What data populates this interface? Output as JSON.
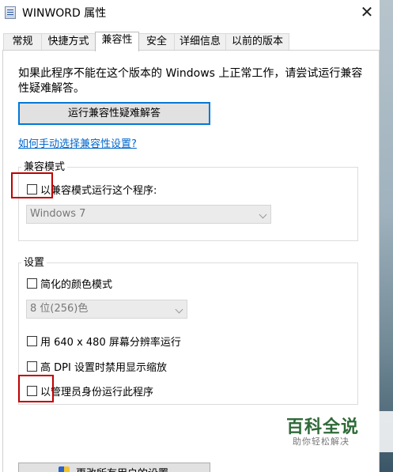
{
  "window": {
    "title": "WINWORD 属性",
    "close_glyph": "✕"
  },
  "tabs": [
    {
      "label": "常规"
    },
    {
      "label": "快捷方式"
    },
    {
      "label": "兼容性"
    },
    {
      "label": "安全"
    },
    {
      "label": "详细信息"
    },
    {
      "label": "以前的版本"
    }
  ],
  "active_tab": "兼容性",
  "compat": {
    "intro": "如果此程序不能在这个版本的 Windows 上正常工作，请尝试运行兼容性疑难解答。",
    "troubleshoot_button": "运行兼容性疑难解答",
    "manual_link": "如何手动选择兼容性设置?",
    "mode_group_label": "兼容模式",
    "mode_checkbox": "以兼容模式运行这个程序:",
    "mode_select": "Windows 7",
    "settings_group_label": "设置",
    "reduced_color": "简化的颜色模式",
    "color_select": "8 位(256)色",
    "low_res": "用 640 x 480 屏幕分辨率运行",
    "dpi": "高 DPI 设置时禁用显示缩放",
    "admin": "以管理员身份运行此程序",
    "all_users_button": "更改所有用户的设置"
  },
  "watermark": {
    "title": "百科全说",
    "subtitle": "助你轻松解决"
  },
  "colors": {
    "highlight_box": "#c00000",
    "link": "#0066cc",
    "button_focus": "#0078d7"
  }
}
